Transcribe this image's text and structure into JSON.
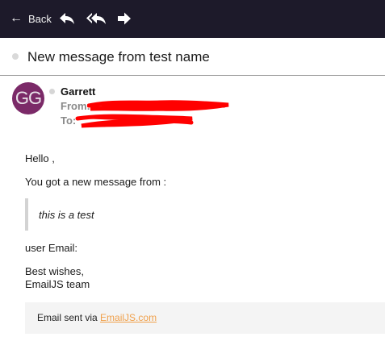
{
  "toolbar": {
    "back_label": "Back",
    "icons": [
      "back-arrow-icon",
      "reply-icon",
      "reply-all-icon",
      "forward-icon"
    ]
  },
  "message": {
    "subject": "New message from test name",
    "avatar_initials": "GG",
    "sender_name": "Garrett",
    "from_label": "From:",
    "to_label": "To:",
    "body": {
      "greeting": "Hello ,",
      "intro": "You got a new message from :",
      "quote": "this is a test",
      "user_email": "user Email:",
      "sign_off_line1": "Best wishes,",
      "sign_off_line2": "EmailJS team"
    },
    "footer": {
      "prefix": "Email sent via",
      "link_text": "EmailJS.com"
    }
  },
  "colors": {
    "toolbar_bg": "#1d1a2a",
    "avatar_bg": "#7b2a68",
    "link": "#f0a04b",
    "redaction": "#ff0000"
  }
}
